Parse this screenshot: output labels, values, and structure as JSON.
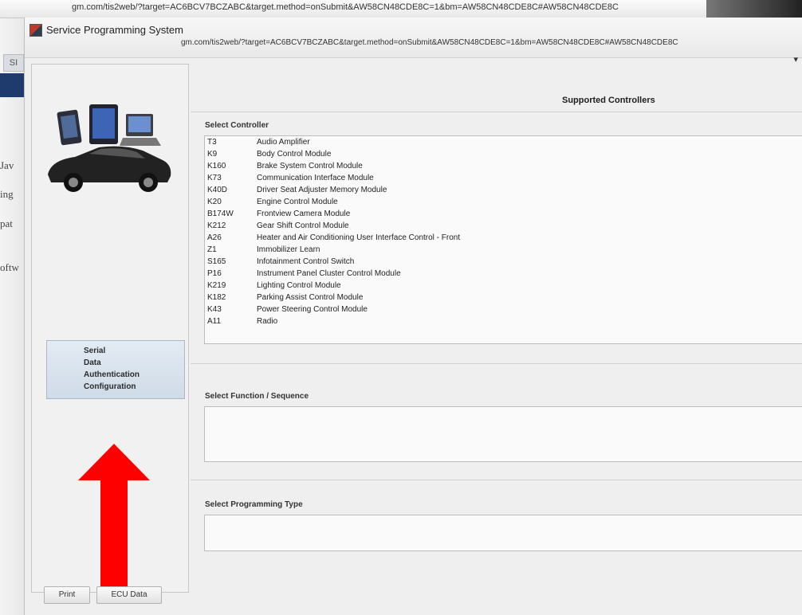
{
  "browser": {
    "url": "gm.com/tis2web/?target=AC6BCV7BCZABC&target.method=onSubmit&AW58CN48CDE8C=1&bm=AW58CN48CDE8C#AW58CN48CDE8C"
  },
  "left_fragments": [
    "SI",
    "Jav",
    "ing",
    "pat",
    "oftw"
  ],
  "window": {
    "title": "Service Programming System",
    "subtitle_url": "gm.com/tis2web/?target=AC6BCV7BCZABC&target.method=onSubmit&AW58CN48CDE8C=1&bm=AW58CN48CDE8C#AW58CN48CDE8C",
    "menu_arrow": "▾"
  },
  "side_menu": {
    "items": [
      "Serial",
      "Data",
      "Authentication",
      "Configuration"
    ]
  },
  "main": {
    "supported_title": "Supported Controllers",
    "select_controller_label": "Select Controller",
    "controllers": [
      {
        "code": "T3",
        "name": "Audio Amplifier"
      },
      {
        "code": "K9",
        "name": "Body Control Module"
      },
      {
        "code": "K160",
        "name": "Brake System Control Module"
      },
      {
        "code": "K73",
        "name": "Communication Interface Module"
      },
      {
        "code": "K40D",
        "name": "Driver Seat Adjuster Memory Module"
      },
      {
        "code": "K20",
        "name": "Engine Control Module"
      },
      {
        "code": "B174W",
        "name": "Frontview Camera Module"
      },
      {
        "code": "K212",
        "name": "Gear Shift Control Module"
      },
      {
        "code": "A26",
        "name": "Heater and Air Conditioning User Interface Control - Front"
      },
      {
        "code": "Z1",
        "name": "Immobilizer Learn"
      },
      {
        "code": "S165",
        "name": "Infotainment Control Switch"
      },
      {
        "code": "P16",
        "name": "Instrument Panel Cluster Control Module"
      },
      {
        "code": "K219",
        "name": "Lighting Control Module"
      },
      {
        "code": "K182",
        "name": "Parking Assist Control Module"
      },
      {
        "code": "K43",
        "name": "Power Steering Control Module"
      },
      {
        "code": "A11",
        "name": "Radio"
      }
    ],
    "select_function_label": "Select Function / Sequence",
    "select_programming_label": "Select Programming Type"
  },
  "buttons": {
    "print": "Print",
    "ecu_data": "ECU Data"
  },
  "colors": {
    "arrow": "#ff0000",
    "menu_box": "#d6e1ec"
  }
}
